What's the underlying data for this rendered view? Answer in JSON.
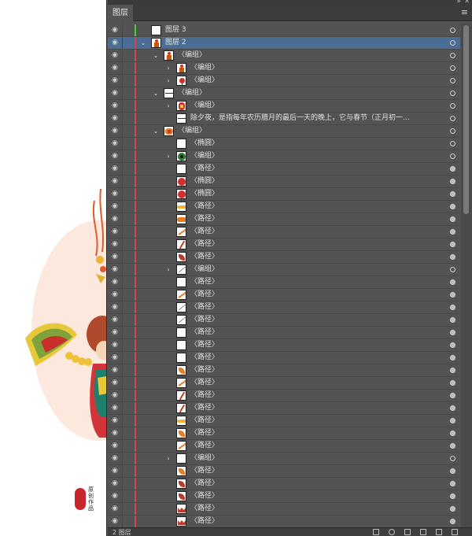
{
  "panel": {
    "title": "图层",
    "footer_label": "2 图层"
  },
  "colors": {
    "layer3_color": "#3fd13f",
    "layer2_color": "#d94545",
    "selection": "#4b6d93"
  },
  "icons": {
    "visibility": "eye-icon",
    "expanded": "chevron-down-icon",
    "collapsed": "chevron-right-icon",
    "target": "target-circle-icon",
    "menu": "panel-menu-icon"
  },
  "canvas": {
    "stamp_text": "原创作品"
  },
  "rows": [
    {
      "label": "图层 3",
      "level": 0,
      "twist": "",
      "thumb": "blank",
      "target": "hollow"
    },
    {
      "label": "图层 2",
      "level": 0,
      "twist": "expanded",
      "thumb": "figure",
      "target": "hollow"
    },
    {
      "label": "〈编组〉",
      "level": 1,
      "twist": "expanded",
      "thumb": "figure",
      "target": "hollow"
    },
    {
      "label": "〈编组〉",
      "level": 2,
      "twist": "collapsed",
      "thumb": "figure",
      "target": "hollow"
    },
    {
      "label": "〈编组〉",
      "level": 2,
      "twist": "collapsed",
      "thumb": "redflower",
      "target": "hollow"
    },
    {
      "label": "〈编组〉",
      "level": 1,
      "twist": "expanded",
      "thumb": "line",
      "target": "hollow"
    },
    {
      "label": "〈编组〉",
      "level": 2,
      "twist": "collapsed",
      "thumb": "redmask",
      "target": "hollow"
    },
    {
      "label": "除夕夜，是指每年农历腊月的最后一天的晚上，它与春节（正月初一...",
      "level": 2,
      "twist": "",
      "thumb": "line",
      "target": "hollow"
    },
    {
      "label": "〈编组〉",
      "level": 1,
      "twist": "expanded",
      "thumb": "fireworks",
      "target": "hollow"
    },
    {
      "label": "〈椭圆〉",
      "level": 2,
      "twist": "",
      "thumb": "blank",
      "target": "hollow"
    },
    {
      "label": "〈编组〉",
      "level": 2,
      "twist": "collapsed",
      "thumb": "greeneye",
      "target": "hollow"
    },
    {
      "label": "〈路径〉",
      "level": 2,
      "twist": "",
      "thumb": "blank",
      "target": "filled"
    },
    {
      "label": "〈椭圆〉",
      "level": 2,
      "twist": "",
      "thumb": "redcircle",
      "target": "filled"
    },
    {
      "label": "〈椭圆〉",
      "level": 2,
      "twist": "",
      "thumb": "redcircle",
      "target": "filled"
    },
    {
      "label": "〈路径〉",
      "level": 2,
      "twist": "",
      "thumb": "yellowwave",
      "target": "filled"
    },
    {
      "label": "〈路径〉",
      "level": 2,
      "twist": "",
      "thumb": "orangewave",
      "target": "filled"
    },
    {
      "label": "〈路径〉",
      "level": 2,
      "twist": "",
      "thumb": "orangediag",
      "target": "filled"
    },
    {
      "label": "〈路径〉",
      "level": 2,
      "twist": "",
      "thumb": "reddiag",
      "target": "filled"
    },
    {
      "label": "〈路径〉",
      "level": 2,
      "twist": "",
      "thumb": "redleaf",
      "target": "filled"
    },
    {
      "label": "〈编组〉",
      "level": 2,
      "twist": "collapsed",
      "thumb": "greydiag",
      "target": "hollow"
    },
    {
      "label": "〈路径〉",
      "level": 2,
      "twist": "",
      "thumb": "blank",
      "target": "filled"
    },
    {
      "label": "〈路径〉",
      "level": 2,
      "twist": "",
      "thumb": "orangediag",
      "target": "filled"
    },
    {
      "label": "〈路径〉",
      "level": 2,
      "twist": "",
      "thumb": "greydiag",
      "target": "filled"
    },
    {
      "label": "〈路径〉",
      "level": 2,
      "twist": "",
      "thumb": "greydiag",
      "target": "filled"
    },
    {
      "label": "〈路径〉",
      "level": 2,
      "twist": "",
      "thumb": "blank",
      "target": "filled"
    },
    {
      "label": "〈路径〉",
      "level": 2,
      "twist": "",
      "thumb": "blank",
      "target": "filled"
    },
    {
      "label": "〈路径〉",
      "level": 2,
      "twist": "",
      "thumb": "blank",
      "target": "filled"
    },
    {
      "label": "〈路径〉",
      "level": 2,
      "twist": "",
      "thumb": "orangeleaf",
      "target": "filled"
    },
    {
      "label": "〈路径〉",
      "level": 2,
      "twist": "",
      "thumb": "orangediag",
      "target": "filled"
    },
    {
      "label": "〈路径〉",
      "level": 2,
      "twist": "",
      "thumb": "reddiag",
      "target": "filled"
    },
    {
      "label": "〈路径〉",
      "level": 2,
      "twist": "",
      "thumb": "reddiag",
      "target": "filled"
    },
    {
      "label": "〈路径〉",
      "level": 2,
      "twist": "",
      "thumb": "yellowwave",
      "target": "filled"
    },
    {
      "label": "〈路径〉",
      "level": 2,
      "twist": "",
      "thumb": "orangeleaf",
      "target": "filled"
    },
    {
      "label": "〈路径〉",
      "level": 2,
      "twist": "",
      "thumb": "orangediag",
      "target": "filled"
    },
    {
      "label": "〈编组〉",
      "level": 2,
      "twist": "collapsed",
      "thumb": "blank",
      "target": "hollow"
    },
    {
      "label": "〈路径〉",
      "level": 2,
      "twist": "",
      "thumb": "orangeleaf",
      "target": "filled"
    },
    {
      "label": "〈路径〉",
      "level": 2,
      "twist": "",
      "thumb": "redleaf",
      "target": "filled"
    },
    {
      "label": "〈路径〉",
      "level": 2,
      "twist": "",
      "thumb": "redleaf",
      "target": "filled"
    },
    {
      "label": "〈路径〉",
      "level": 2,
      "twist": "",
      "thumb": "redcrown",
      "target": "filled"
    },
    {
      "label": "〈路径〉",
      "level": 2,
      "twist": "",
      "thumb": "redcrown",
      "target": "filled"
    },
    {
      "label": "〈路径〉",
      "level": 2,
      "twist": "",
      "thumb": "greydiag",
      "target": "filled"
    }
  ]
}
